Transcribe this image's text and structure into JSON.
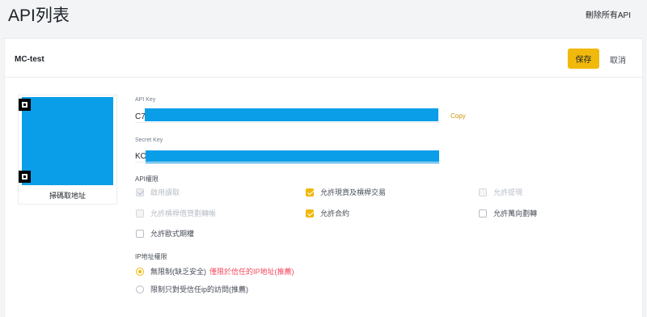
{
  "header": {
    "title": "API列表",
    "delete_all": "刪除所有API"
  },
  "api": {
    "name": "MC-test",
    "save": "保存",
    "cancel": "取消",
    "qr_caption": "掃碼取地址",
    "api_key_label": "API Key",
    "api_key_prefix": "C7",
    "copy": "Copy",
    "secret_key_label": "Secret Key",
    "secret_key_prefix": "KO"
  },
  "permissions": {
    "label": "API權限",
    "items": [
      {
        "label": "啟用讀取",
        "checked": true,
        "disabled": true
      },
      {
        "label": "允許現貨及槓桿交易",
        "checked": true,
        "disabled": false
      },
      {
        "label": "允許提現",
        "checked": false,
        "disabled": true
      },
      {
        "label": "允許槓桿借貸劃轉帳",
        "checked": false,
        "disabled": true
      },
      {
        "label": "允許合約",
        "checked": true,
        "disabled": false
      },
      {
        "label": "允許萬向劃轉",
        "checked": false,
        "disabled": false
      },
      {
        "label": "允許歐式期權",
        "checked": false,
        "disabled": false
      }
    ]
  },
  "ip_access": {
    "label": "IP地址權限",
    "unrestricted": "無限制(缺乏安全)",
    "unrestricted_warning": "僅限於信任的IP地址(推薦)",
    "restricted": "限制只對受信任ip的訪問(推薦)",
    "selected": "unrestricted"
  },
  "colors": {
    "accent": "#f0b90b",
    "redaction": "#0a9ee8",
    "warning": "#f6465d",
    "copy_link": "#c99400"
  }
}
